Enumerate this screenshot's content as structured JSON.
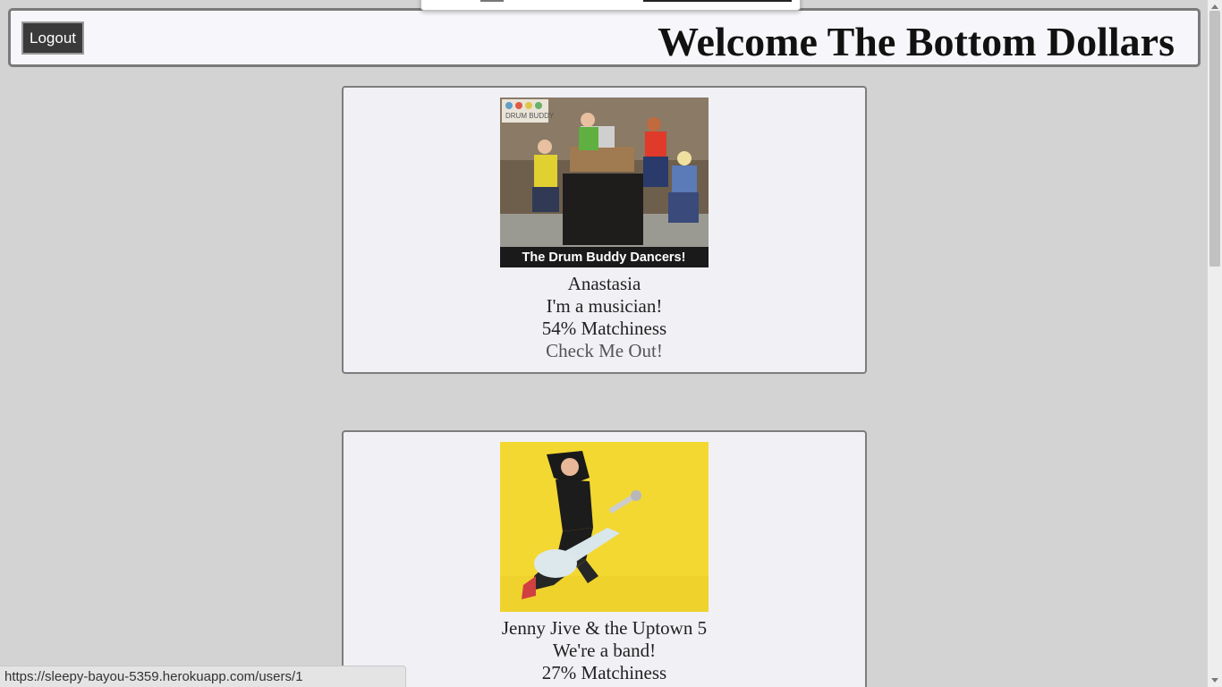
{
  "header": {
    "logout_label": "Logout",
    "welcome_text": "Welcome The Bottom Dollars"
  },
  "cards": [
    {
      "image_caption": "The Drum Buddy Dancers!",
      "image_logo": "DRUM BUDDY",
      "name": "Anastasia",
      "tagline": "I'm a musician!",
      "match": "54% Matchiness",
      "link": "Check Me Out!"
    },
    {
      "name": "Jenny Jive & the Uptown 5",
      "tagline": "We're a band!",
      "match": "27% Matchiness"
    }
  ],
  "status_bar": {
    "url": "https://sleepy-bayou-5359.herokuapp.com/users/1"
  },
  "colors": {
    "page_bg": "#d3d3d3",
    "card_bg": "#f0f0f5",
    "button_bg": "#3a3a3a",
    "photo2_bg": "#f3d832"
  }
}
